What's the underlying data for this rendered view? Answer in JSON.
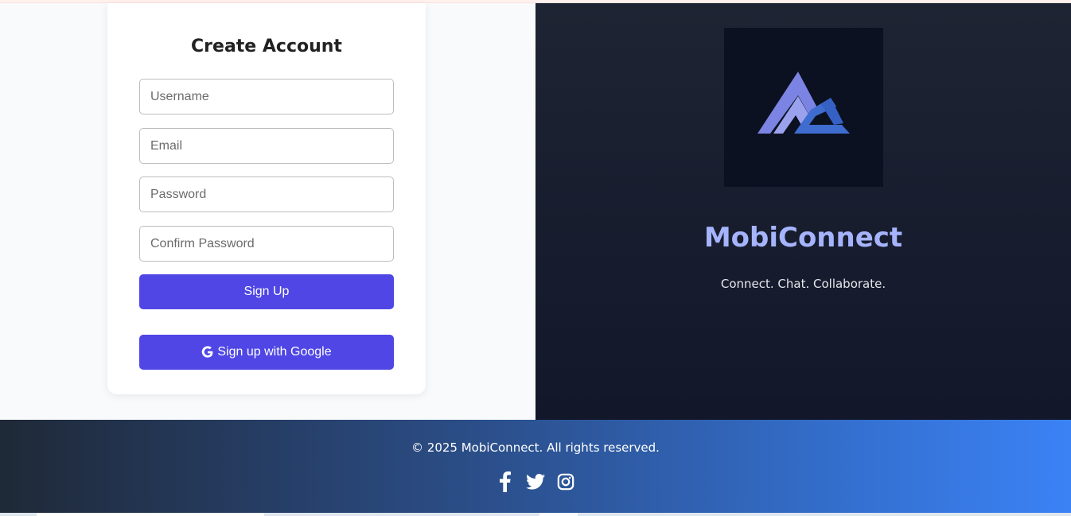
{
  "signup": {
    "title": "Create Account",
    "username_placeholder": "Username",
    "email_placeholder": "Email",
    "password_placeholder": "Password",
    "confirm_password_placeholder": "Confirm Password",
    "submit_label": "Sign Up",
    "google_label": "Sign up with Google"
  },
  "brand": {
    "name": "MobiConnect",
    "tagline": "Connect. Chat. Collaborate.",
    "logo_icon": "mc-logo-icon"
  },
  "footer": {
    "copyright": "© 2025 MobiConnect. All rights reserved.",
    "social_icons": [
      "facebook-icon",
      "twitter-icon",
      "instagram-icon"
    ]
  },
  "colors": {
    "primary_button": "#4f46e5",
    "brand_text": "#a5b4fc",
    "panel_dark": "#1e2433",
    "footer_gradient_start": "#1f2937",
    "footer_gradient_end": "#3b82f6"
  }
}
